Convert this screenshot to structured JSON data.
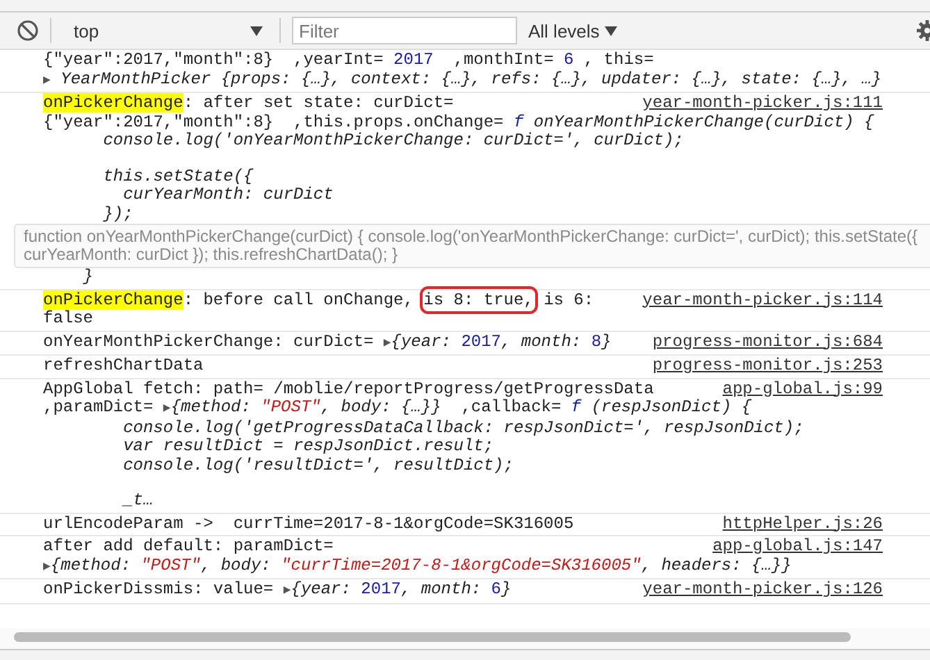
{
  "toolbar": {
    "context": "top",
    "filter": {
      "placeholder": "Filter"
    },
    "levels": "All levels"
  },
  "entries": [
    {
      "lines": [
        [
          {
            "kind": "t",
            "text": "{\"year\":2017,\"month\":8}  ,yearInt= "
          },
          {
            "kind": "n",
            "text": "2017"
          },
          {
            "kind": "t",
            "text": "  ,monthInt= "
          },
          {
            "kind": "n",
            "text": "6"
          },
          {
            "kind": "t",
            "text": " , this="
          }
        ],
        [
          {
            "kind": "tri",
            "text": "▶"
          },
          {
            "kind": "i",
            "text": " YearMonthPicker {props: {…}, context: {…}, refs: {…}, updater: {…}, state: {…}, …}"
          }
        ]
      ]
    },
    {
      "source": "year-month-picker.js:111",
      "lines": [
        [
          {
            "kind": "hl",
            "text": "onPickerChange"
          },
          {
            "kind": "t",
            "text": ": after set state: curDict="
          }
        ],
        [
          {
            "kind": "t",
            "text": "{\"year\":2017,\"month\":8}  ,this.props.onChange= "
          },
          {
            "kind": "f",
            "text": "f"
          },
          {
            "kind": "i",
            "text": " onYearMonthPickerChange(curDict) {"
          }
        ],
        [
          {
            "kind": "i",
            "text": "      console.log('onYearMonthPickerChange: curDict=', curDict);"
          }
        ],
        [
          {
            "kind": "gap"
          }
        ],
        [
          {
            "kind": "i",
            "text": "      this.setState({"
          }
        ],
        [
          {
            "kind": "i",
            "text": "        curYearMonth: curDict"
          }
        ],
        [
          {
            "kind": "i",
            "text": "      });"
          }
        ],
        [
          {
            "kind": "tipgap"
          }
        ],
        [
          {
            "kind": "i",
            "text": "    }"
          }
        ]
      ]
    },
    {
      "source": "year-month-picker.js:114",
      "lines": [
        [
          {
            "kind": "hl",
            "text": "onPickerChange"
          },
          {
            "kind": "t",
            "text": ": before call onChange, "
          },
          {
            "kind": "box",
            "text": "is 8: true,"
          },
          {
            "kind": "t",
            "text": " is 6:"
          }
        ],
        [
          {
            "kind": "t",
            "text": "false"
          }
        ]
      ]
    },
    {
      "source": "progress-monitor.js:684",
      "lines": [
        [
          {
            "kind": "t",
            "text": "onYearMonthPickerChange: curDict= "
          },
          {
            "kind": "tri",
            "text": "▶"
          },
          {
            "kind": "i",
            "text": "{year: "
          },
          {
            "kind": "n",
            "text": "2017"
          },
          {
            "kind": "i",
            "text": ", month: "
          },
          {
            "kind": "n",
            "text": "8"
          },
          {
            "kind": "i",
            "text": "}"
          }
        ]
      ]
    },
    {
      "source": "progress-monitor.js:253",
      "lines": [
        [
          {
            "kind": "t",
            "text": "refreshChartData"
          }
        ]
      ]
    },
    {
      "source": "app-global.js:99",
      "lines": [
        [
          {
            "kind": "t",
            "text": "AppGlobal fetch: path= /moblie/reportProgress/getProgressData"
          }
        ],
        [
          {
            "kind": "t",
            "text": ",paramDict= "
          },
          {
            "kind": "tri",
            "text": "▶"
          },
          {
            "kind": "i",
            "text": "{method: "
          },
          {
            "kind": "s",
            "text": "\"POST\""
          },
          {
            "kind": "i",
            "text": ", body: {…}}"
          },
          {
            "kind": "t",
            "text": "  ,callback= "
          },
          {
            "kind": "f",
            "text": "f"
          },
          {
            "kind": "i",
            "text": " (respJsonDict) {"
          }
        ],
        [
          {
            "kind": "i",
            "text": "        console.log('getProgressDataCallback: respJsonDict=', respJsonDict);"
          }
        ],
        [
          {
            "kind": "i",
            "text": "        var resultDict = respJsonDict.result;"
          }
        ],
        [
          {
            "kind": "i",
            "text": "        console.log('resultDict=', resultDict);"
          }
        ],
        [
          {
            "kind": "gap"
          }
        ],
        [
          {
            "kind": "i",
            "text": "        _t…"
          }
        ]
      ]
    },
    {
      "source": "httpHelper.js:26",
      "lines": [
        [
          {
            "kind": "t",
            "text": "urlEncodeParam ->  currTime=2017-8-1&orgCode=SK316005"
          }
        ]
      ]
    },
    {
      "source": "app-global.js:147",
      "lines": [
        [
          {
            "kind": "t",
            "text": "after add default: paramDict="
          }
        ],
        [
          {
            "kind": "tri",
            "text": "▶"
          },
          {
            "kind": "i",
            "text": "{method: "
          },
          {
            "kind": "s",
            "text": "\"POST\""
          },
          {
            "kind": "i",
            "text": ", body: "
          },
          {
            "kind": "s",
            "text": "\"currTime=2017-8-1&orgCode=SK316005\""
          },
          {
            "kind": "i",
            "text": ", headers: {…}}"
          }
        ]
      ]
    },
    {
      "source": "year-month-picker.js:126",
      "lines": [
        [
          {
            "kind": "t",
            "text": "onPickerDissmis: value= "
          },
          {
            "kind": "tri",
            "text": "▶"
          },
          {
            "kind": "i",
            "text": "{year: "
          },
          {
            "kind": "n",
            "text": "2017"
          },
          {
            "kind": "i",
            "text": ", month: "
          },
          {
            "kind": "n",
            "text": "6"
          },
          {
            "kind": "i",
            "text": "}"
          }
        ]
      ]
    }
  ],
  "tooltip": {
    "lines": [
      "function onYearMonthPickerChange(curDict) { console.log('onYearMonthPickerChange: curDict=', curDict); this.setState({",
      "curYearMonth: curDict }); this.refreshChartData(); }"
    ]
  }
}
